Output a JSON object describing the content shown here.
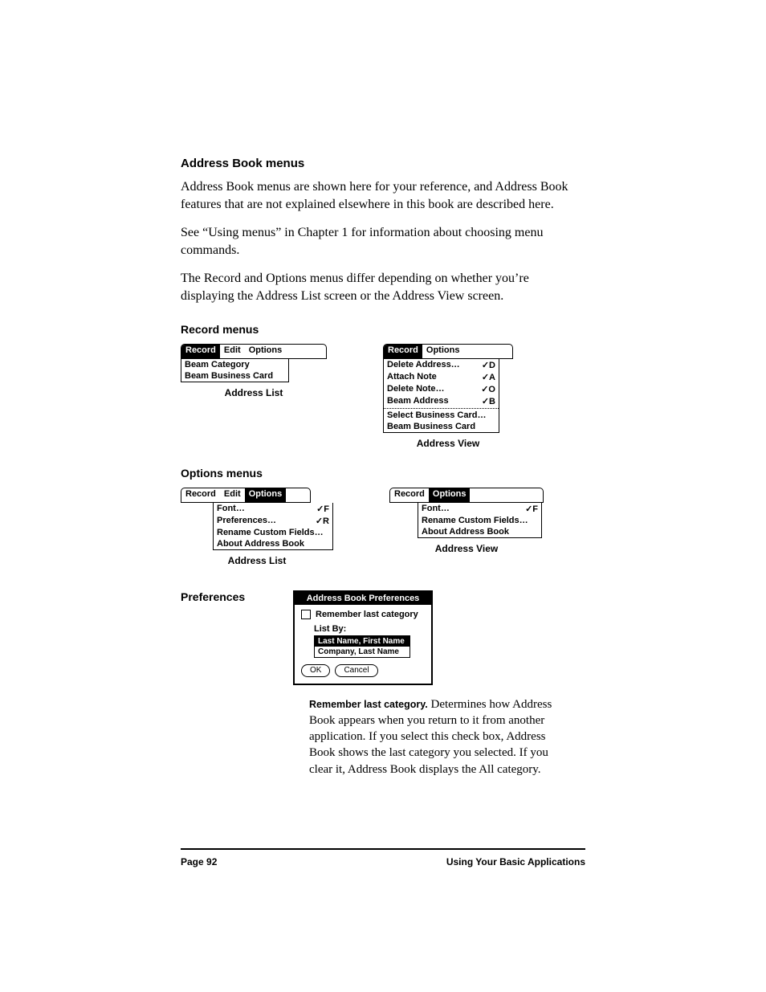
{
  "headings": {
    "h1": "Address Book menus",
    "h2": "Record menus",
    "h3": "Options menus"
  },
  "paragraphs": {
    "p1": "Address Book menus are shown here for your reference, and Address Book features that are not explained elsewhere in this book are described here.",
    "p2": "See “Using menus” in Chapter 1 for information about choosing menu commands.",
    "p3": "The Record and Options menus differ depending on whether you’re displaying the Address List screen or the Address View screen."
  },
  "menus": {
    "record_list": {
      "tabs": {
        "record": "Record",
        "edit": "Edit",
        "options": "Options"
      },
      "items": [
        {
          "label": "Beam Category"
        },
        {
          "label": "Beam Business Card"
        }
      ],
      "caption": "Address List"
    },
    "record_view": {
      "tabs": {
        "record": "Record",
        "options": "Options"
      },
      "items": [
        {
          "label": "Delete Address…",
          "shortcut": "✓D"
        },
        {
          "label": "Attach Note",
          "shortcut": "✓A"
        },
        {
          "label": "Delete Note…",
          "shortcut": "✓O"
        },
        {
          "label": "Beam Address",
          "shortcut": "✓B"
        }
      ],
      "items2": [
        {
          "label": "Select Business Card…"
        },
        {
          "label": "Beam Business Card"
        }
      ],
      "caption": "Address View"
    },
    "options_list": {
      "tabs": {
        "record": "Record",
        "edit": "Edit",
        "options": "Options"
      },
      "items": [
        {
          "label": "Font…",
          "shortcut": "✓F"
        },
        {
          "label": "Preferences…",
          "shortcut": "✓R"
        },
        {
          "label": "Rename Custom Fields…"
        },
        {
          "label": "About Address Book"
        }
      ],
      "caption": "Address List"
    },
    "options_view": {
      "tabs": {
        "record": "Record",
        "options": "Options"
      },
      "items": [
        {
          "label": "Font…",
          "shortcut": "✓F"
        },
        {
          "label": "Rename Custom Fields…"
        },
        {
          "label": "About Address Book"
        }
      ],
      "caption": "Address View"
    }
  },
  "preferences": {
    "side_label": "Preferences",
    "dialog_title": "Address Book Preferences",
    "remember_label": "Remember last category",
    "listby_label": "List By:",
    "options": {
      "opt1": "Last Name, First Name",
      "opt2": "Company, Last Name"
    },
    "ok": "OK",
    "cancel": "Cancel"
  },
  "description": {
    "lead": "Remember last category.",
    "body": " Determines how Address Book appears when you return to it from another application. If you select this check box, Address Book shows the last category you selected. If you clear it, Address Book displays the All category."
  },
  "footer": {
    "left": "Page 92",
    "right": "Using Your Basic Applications"
  }
}
